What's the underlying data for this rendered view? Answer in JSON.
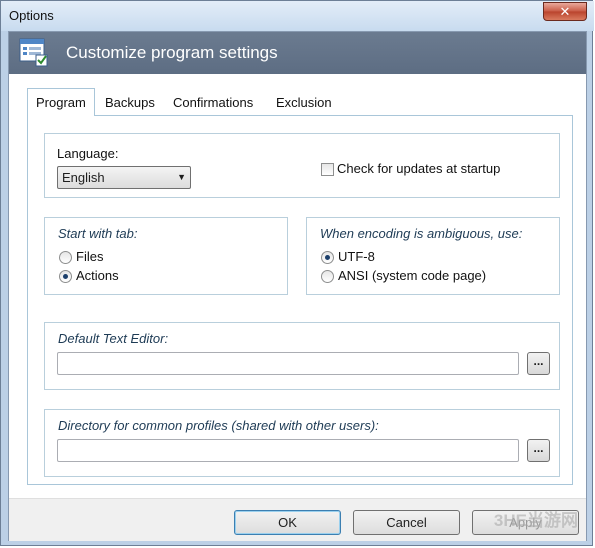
{
  "window": {
    "title": "Options",
    "close_glyph": "✕"
  },
  "banner": {
    "title": "Customize program settings",
    "icon": "settings-window-icon"
  },
  "tabs": [
    {
      "label": "Program",
      "active": true
    },
    {
      "label": "Backups",
      "active": false
    },
    {
      "label": "Confirmations",
      "active": false
    },
    {
      "label": "Exclusion",
      "active": false
    }
  ],
  "language": {
    "label": "Language:",
    "selected": "English",
    "arrow": "▼"
  },
  "updates": {
    "label": "Check for updates at startup",
    "checked": false
  },
  "start_tab": {
    "label": "Start with tab:",
    "options": [
      {
        "label": "Files",
        "checked": false
      },
      {
        "label": "Actions",
        "checked": true
      }
    ]
  },
  "encoding": {
    "label": "When encoding is ambiguous, use:",
    "options": [
      {
        "label": "UTF-8",
        "checked": true
      },
      {
        "label": "ANSI (system code page)",
        "checked": false
      }
    ]
  },
  "text_editor": {
    "label": "Default Text Editor:",
    "value": "",
    "browse_label": "..."
  },
  "common_profiles": {
    "label": "Directory for common profiles (shared with other users):",
    "value": "",
    "browse_label": "..."
  },
  "footer": {
    "ok_label": "OK",
    "cancel_label": "Cancel",
    "apply_label": "Apply"
  },
  "watermark": "3HE当游网",
  "colors": {
    "banner": "#66768b",
    "panel_border": "#a9c6d9",
    "window_frame": "#bcd0e6"
  }
}
